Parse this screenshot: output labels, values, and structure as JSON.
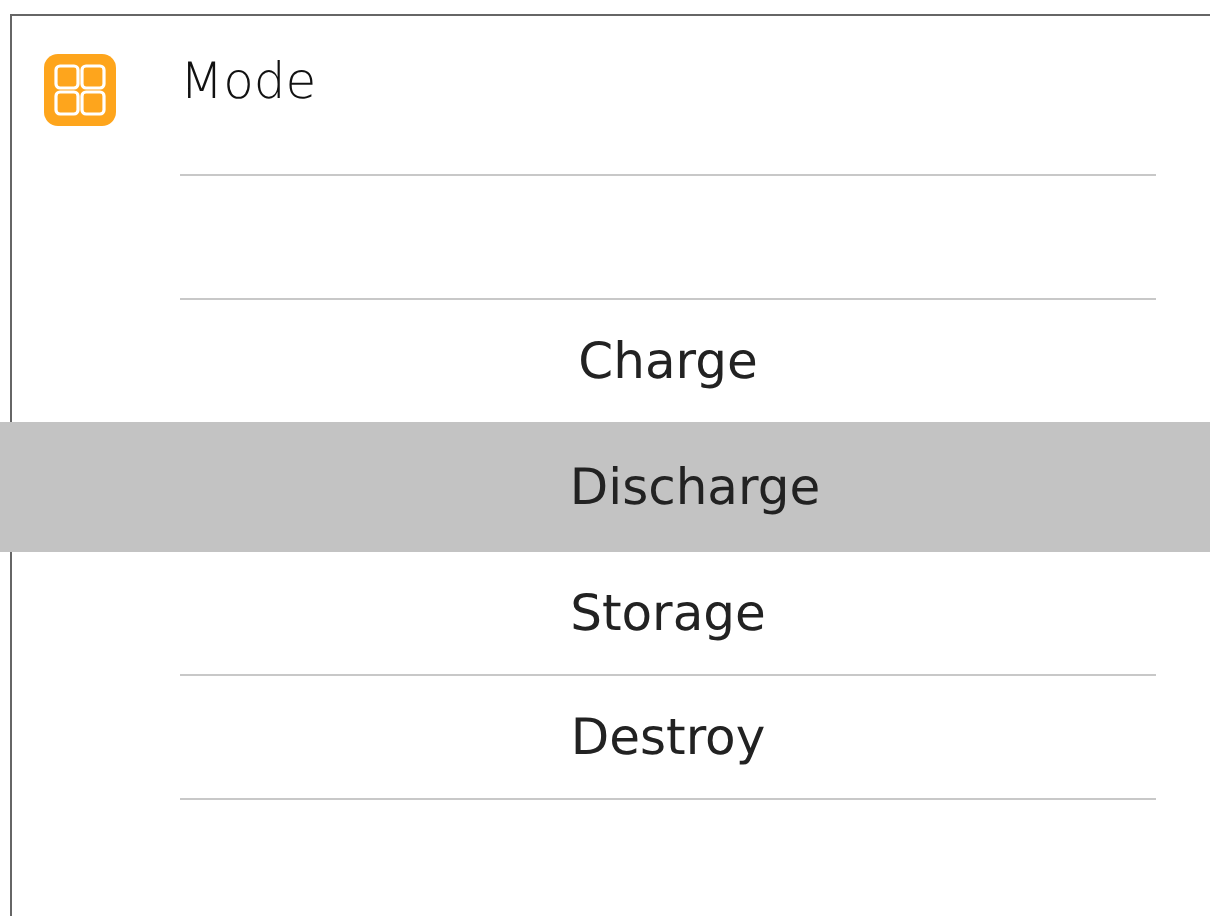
{
  "header": {
    "title": "Mode"
  },
  "options": [
    {
      "label": "Charge",
      "selected": false
    },
    {
      "label": "Discharge",
      "selected": true
    },
    {
      "label": "Storage",
      "selected": false
    },
    {
      "label": "Destroy",
      "selected": false
    }
  ]
}
